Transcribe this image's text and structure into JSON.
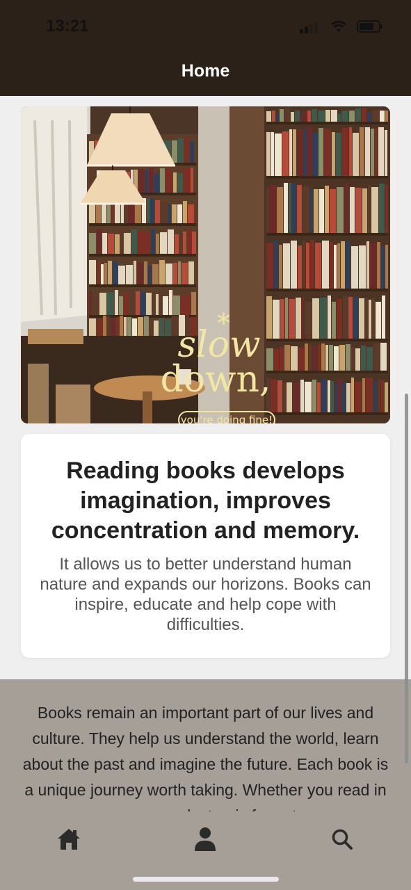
{
  "status_bar": {
    "time": "13:21"
  },
  "header": {
    "title": "Home"
  },
  "hero": {
    "star": "*",
    "quote_line1": "slow",
    "quote_line2": "down,",
    "pill_text": "you're doing fine!"
  },
  "card": {
    "heading": "Reading books develops imagination, improves concentration and memory.",
    "body": "It allows us to better understand human nature and expands our horizons. Books can inspire, educate and help cope with difficulties."
  },
  "panel": {
    "text": "Books remain an important part of our lives and culture. They help us understand the world, learn about the past and imagine the future. Each book is a unique journey worth taking. Whether you read in paper or electronic format"
  },
  "tab_bar": {
    "items": [
      {
        "name": "home",
        "icon": "home-icon"
      },
      {
        "name": "profile",
        "icon": "person-icon"
      },
      {
        "name": "search",
        "icon": "search-icon"
      }
    ]
  },
  "colors": {
    "header_bg": "#2c2119",
    "page_bg": "#efefef",
    "panel_bg": "#a59f98",
    "quote_color": "#f2e6a4",
    "icon_color": "#2b2b2b"
  }
}
